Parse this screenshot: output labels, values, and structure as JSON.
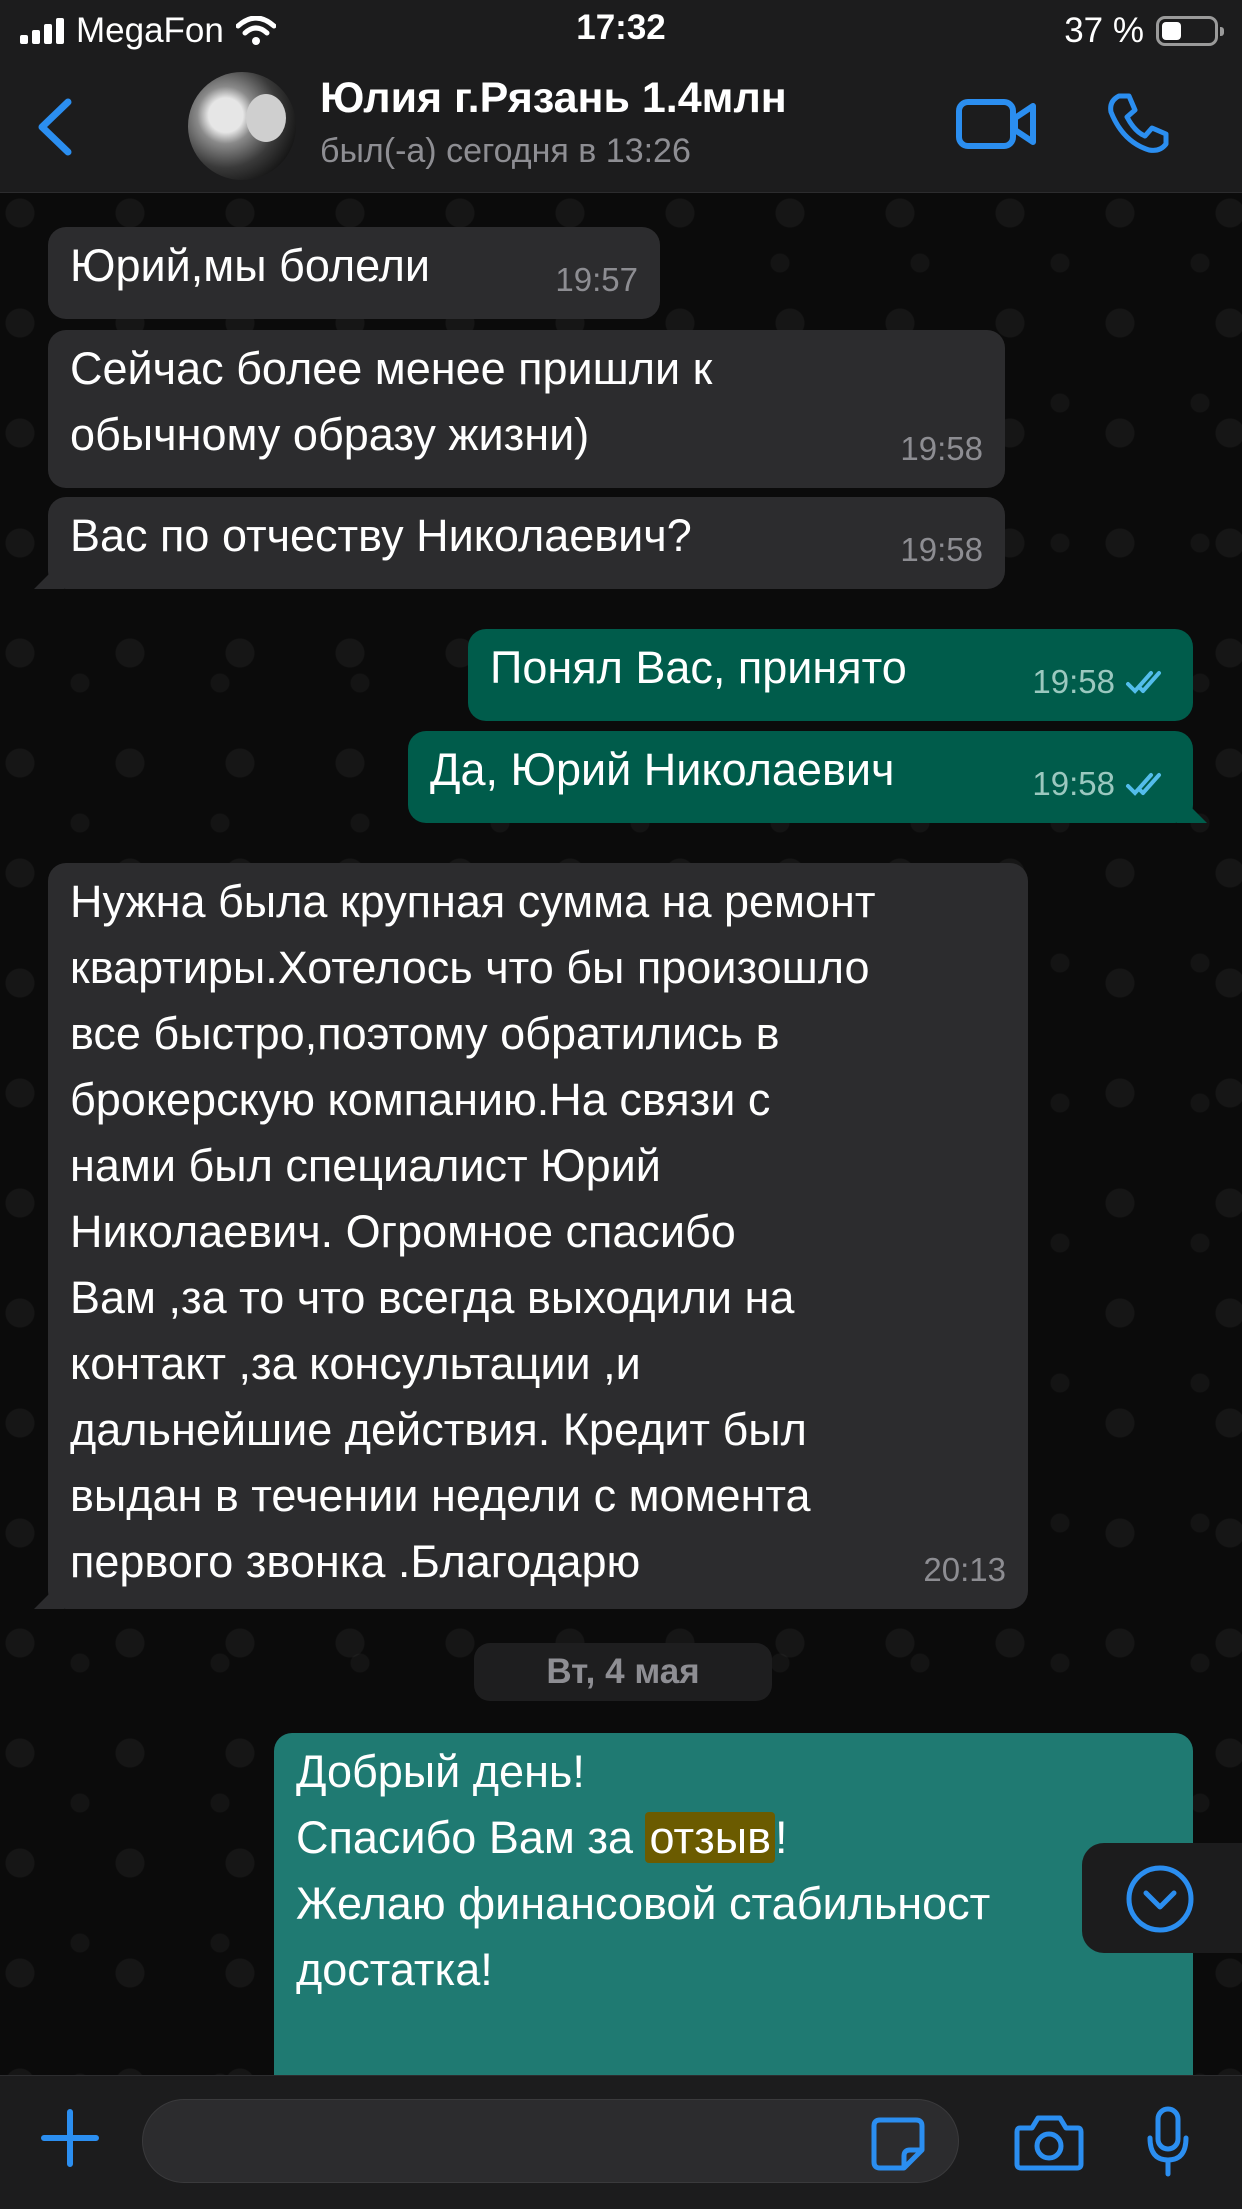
{
  "status_bar": {
    "carrier": "MegaFon",
    "time": "17:32",
    "battery": "37 %",
    "battery_level": 0.37
  },
  "header": {
    "contact_name": "Юлия г.Рязань 1.4млн",
    "last_seen": "был(-а) сегодня в 13:26"
  },
  "messages": [
    {
      "direction": "in",
      "text": "Юрий,мы болели",
      "time": "19:57"
    },
    {
      "direction": "in",
      "text": "Сейчас более менее пришли к\nобычному образу жизни)",
      "time": "19:58"
    },
    {
      "direction": "in",
      "text": "Вас по отчеству Николаевич?",
      "time": "19:58"
    },
    {
      "direction": "out",
      "text": "Понял Вас, принято",
      "time": "19:58",
      "read": true
    },
    {
      "direction": "out",
      "text": "Да, Юрий Николаевич",
      "time": "19:58",
      "read": true
    },
    {
      "direction": "in",
      "text": "Нужна была крупная сумма на ремонт\nквартиры.Хотелось что бы произошло\nвсе быстро,поэтому обратились в\nброкерскую компанию.На связи с\nнами был специалист Юрий\nНиколаевич. Огромное спасибо\nВам ,за то что всегда выходили на\nконтакт ,за консультации ,и\nдальнейшие действия. Кредит был\nвыдан в течении недели с момента\nпервого звонка .Благодарю",
      "time": "20:13"
    }
  ],
  "date_separator": "Вт, 4 мая",
  "last_message": {
    "line1": "Добрый день!",
    "line2_before": "Спасибо Вам за ",
    "line2_highlight": "отзыв",
    "line2_after": "!",
    "line3": "Желаю финансовой стабильност",
    "line4": "достатка!"
  },
  "icons": {
    "back": "chevron-left-icon",
    "video": "video-camera-icon",
    "call": "phone-icon",
    "scroll": "chevron-down-circle-icon",
    "attach": "plus-icon",
    "sticker": "sticker-icon",
    "camera": "camera-icon",
    "mic": "microphone-icon"
  },
  "colors": {
    "accent": "#2b8ef0",
    "incoming_bubble": "#2c2c2e",
    "outgoing_bubble": "#005c4b",
    "read_ticks": "#53bdeb",
    "search_highlight": "#6b5b00"
  }
}
